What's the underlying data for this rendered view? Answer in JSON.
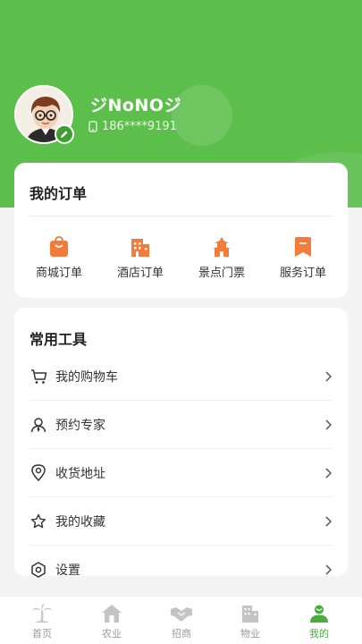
{
  "profile": {
    "username": "ジNoNOジ",
    "phone": "186****9191"
  },
  "orders": {
    "title": "我的订单",
    "items": [
      {
        "label": "商城订单",
        "icon": "shopping-bag-icon"
      },
      {
        "label": "酒店订单",
        "icon": "hotel-icon"
      },
      {
        "label": "景点门票",
        "icon": "pagoda-icon"
      },
      {
        "label": "服务订单",
        "icon": "service-bookmark-icon"
      }
    ]
  },
  "tools": {
    "title": "常用工具",
    "items": [
      {
        "label": "我的购物车",
        "icon": "cart-icon"
      },
      {
        "label": "预约专家",
        "icon": "expert-icon"
      },
      {
        "label": "收货地址",
        "icon": "location-icon"
      },
      {
        "label": "我的收藏",
        "icon": "star-icon"
      },
      {
        "label": "设置",
        "icon": "settings-icon"
      }
    ]
  },
  "tabbar": {
    "items": [
      {
        "label": "首页",
        "icon": "palm-tree-icon",
        "active": false
      },
      {
        "label": "农业",
        "icon": "house-icon",
        "active": false
      },
      {
        "label": "招商",
        "icon": "handshake-icon",
        "active": false
      },
      {
        "label": "物业",
        "icon": "building-icon",
        "active": false
      },
      {
        "label": "我的",
        "icon": "user-icon",
        "active": true
      }
    ]
  },
  "colors": {
    "brand_green": "#5cbf4c",
    "order_icon_orange": "#f47b3a",
    "active_tab": "#49ac3b"
  }
}
